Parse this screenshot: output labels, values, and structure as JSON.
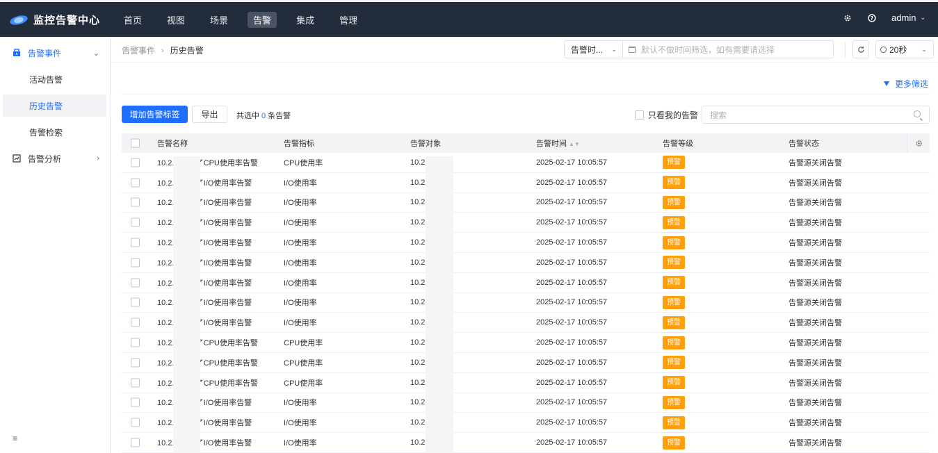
{
  "app": {
    "title": "监控告警中心"
  },
  "nav": {
    "items": [
      {
        "label": "首页"
      },
      {
        "label": "视图"
      },
      {
        "label": "场景"
      },
      {
        "label": "告警",
        "active": true
      },
      {
        "label": "集成"
      },
      {
        "label": "管理"
      }
    ]
  },
  "top_right": {
    "user": "admin"
  },
  "sidebar": {
    "group1": "告警事件",
    "sub1": "活动告警",
    "sub2": "历史告警",
    "sub3": "告警检索",
    "group2": "告警分析"
  },
  "breadcrumb": {
    "parent": "告警事件",
    "current": "历史告警"
  },
  "filters": {
    "time_type": "告警时...",
    "time_range_placeholder": "默认不做时间筛选，如有需要请选择",
    "refresh_interval": "20秒",
    "more_filter": "更多筛选"
  },
  "toolbar": {
    "add_tag": "增加告警标签",
    "export": "导出",
    "selected_prefix": "共选中",
    "selected_count": "0",
    "selected_suffix": "条告警",
    "only_mine": "只看我的告警",
    "search_placeholder": "搜索"
  },
  "table": {
    "headers": {
      "name": "告警名称",
      "metric": "告警指标",
      "object": "告警对象",
      "time": "告警时间",
      "level": "告警等级",
      "status": "告警状态"
    },
    "rows": [
      {
        "name": "10.2.1 发生了CPU使用率告警",
        "metric": "CPU使用率",
        "object": "10.2.",
        "time": "2025-02-17 10:05:57",
        "level": "预警",
        "status": "告警源关闭告警"
      },
      {
        "name": "10.2.1 发生了I/O使用率告警",
        "metric": "I/O使用率",
        "object": "10.2.",
        "time": "2025-02-17 10:05:57",
        "level": "预警",
        "status": "告警源关闭告警"
      },
      {
        "name": "10.2.1 发生了I/O使用率告警",
        "metric": "I/O使用率",
        "object": "10.2.",
        "time": "2025-02-17 10:05:57",
        "level": "预警",
        "status": "告警源关闭告警"
      },
      {
        "name": "10.2.1 发生了I/O使用率告警",
        "metric": "I/O使用率",
        "object": "10.2.",
        "time": "2025-02-17 10:05:57",
        "level": "预警",
        "status": "告警源关闭告警"
      },
      {
        "name": "10.2.1 发生了I/O使用率告警",
        "metric": "I/O使用率",
        "object": "10.2.",
        "time": "2025-02-17 10:05:57",
        "level": "预警",
        "status": "告警源关闭告警"
      },
      {
        "name": "10.2.1 发生了I/O使用率告警",
        "metric": "I/O使用率",
        "object": "10.2.",
        "time": "2025-02-17 10:05:57",
        "level": "预警",
        "status": "告警源关闭告警"
      },
      {
        "name": "10.2.1 发生了I/O使用率告警",
        "metric": "I/O使用率",
        "object": "10.2.",
        "time": "2025-02-17 10:05:57",
        "level": "预警",
        "status": "告警源关闭告警"
      },
      {
        "name": "10.2.1 发生了I/O使用率告警",
        "metric": "I/O使用率",
        "object": "10.2.",
        "time": "2025-02-17 10:05:57",
        "level": "预警",
        "status": "告警源关闭告警"
      },
      {
        "name": "10.2.1 发生了I/O使用率告警",
        "metric": "I/O使用率",
        "object": "10.2.",
        "time": "2025-02-17 10:05:57",
        "level": "预警",
        "status": "告警源关闭告警"
      },
      {
        "name": "10.2.1 发生了CPU使用率告警",
        "metric": "CPU使用率",
        "object": "10.2.",
        "time": "2025-02-17 10:05:57",
        "level": "预警",
        "status": "告警源关闭告警"
      },
      {
        "name": "10.2.1 发生了CPU使用率告警",
        "metric": "CPU使用率",
        "object": "10.2.",
        "time": "2025-02-17 10:05:57",
        "level": "预警",
        "status": "告警源关闭告警"
      },
      {
        "name": "10.2.1 发生了CPU使用率告警",
        "metric": "CPU使用率",
        "object": "10.2.",
        "time": "2025-02-17 10:05:57",
        "level": "预警",
        "status": "告警源关闭告警"
      },
      {
        "name": "10.2.1 发生了I/O使用率告警",
        "metric": "I/O使用率",
        "object": "10.2.",
        "time": "2025-02-17 10:05:57",
        "level": "预警",
        "status": "告警源关闭告警"
      },
      {
        "name": "10.2.1 发生了I/O使用率告警",
        "metric": "I/O使用率",
        "object": "10.2.",
        "time": "2025-02-17 10:05:57",
        "level": "预警",
        "status": "告警源关闭告警"
      },
      {
        "name": "10.2.1 发生了I/O使用率告警",
        "metric": "I/O使用率",
        "object": "10.2.",
        "time": "2025-02-17 10:05:57",
        "level": "预警",
        "status": "告警源关闭告警"
      }
    ]
  },
  "colors": {
    "topbar": "#232c3b",
    "primary": "#1f6fff",
    "warning_badge": "#ff9f0a"
  },
  "icons": {
    "logo": "eye-logo-icon",
    "settings": "gear-icon",
    "help": "help-icon",
    "alarm": "alarm-icon",
    "analysis": "chart-icon",
    "collapse": "collapse-menu-icon",
    "refresh": "refresh-icon",
    "calendar": "calendar-icon",
    "clock": "clock-icon",
    "filter": "filter-icon",
    "search": "search-icon",
    "column_settings": "column-settings-icon"
  }
}
